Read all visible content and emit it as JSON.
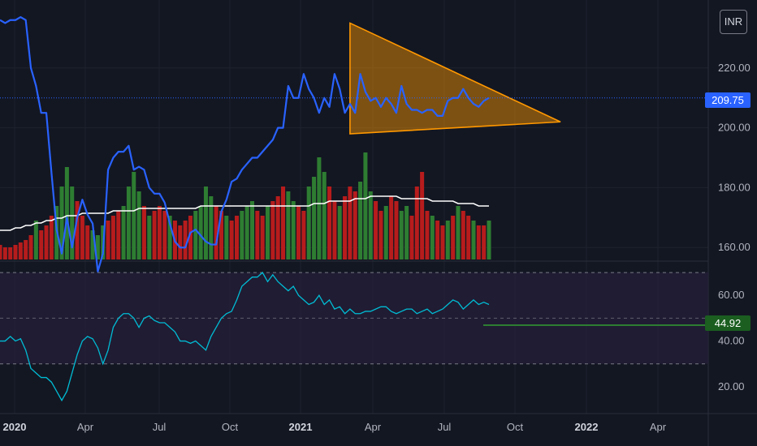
{
  "currency_button": "INR",
  "colors": {
    "background": "#131722",
    "price_line": "#2962ff",
    "rsi_line": "#00bcd4",
    "volume_up": "#2e7d32",
    "volume_down": "#b71c1c",
    "volume_ma": "#ffffff",
    "triangle_stroke": "#ff9800",
    "triangle_fill": "#ff9800",
    "current_price_badge": "#2962ff",
    "rsi_badge": "#1b5e20",
    "rsi_band": "#2a2040"
  },
  "chart_data": [
    {
      "type": "line",
      "name": "price",
      "x_tick_labels": [
        "2020",
        "Apr",
        "Jul",
        "Oct",
        "2021",
        "Apr",
        "Jul",
        "Oct",
        "2022",
        "Apr"
      ],
      "y_tick_labels": [
        "220.00",
        "200.00",
        "180.00",
        "160.00"
      ],
      "ylim": [
        156,
        240
      ],
      "current_value_label": "209.75",
      "series": [
        {
          "values": [
            236,
            235,
            236,
            236,
            237,
            236,
            220,
            214,
            205,
            205,
            185,
            166,
            158,
            170,
            160,
            170,
            176,
            171,
            168,
            152,
            158,
            186,
            190,
            192,
            192,
            194,
            186,
            187,
            186,
            180,
            178,
            178,
            175,
            168,
            162,
            160,
            160,
            165,
            166,
            164,
            162,
            161,
            161,
            172,
            176,
            182,
            183,
            186,
            188,
            190,
            190,
            192,
            194,
            196,
            200,
            200,
            214,
            210,
            210,
            218,
            213,
            210,
            205,
            210,
            207,
            218,
            213,
            205,
            208,
            205,
            218,
            212,
            209,
            210,
            207,
            210,
            208,
            205,
            214,
            208,
            206,
            206,
            205,
            206,
            206,
            204,
            204,
            209,
            210,
            210,
            213,
            210,
            208,
            207,
            209,
            210
          ]
        }
      ],
      "annotations": [
        {
          "type": "triangle",
          "points": [
            [
              68,
              235
            ],
            [
              68,
              198
            ],
            [
              125,
              202
            ]
          ]
        }
      ]
    },
    {
      "type": "bar",
      "name": "volume",
      "series": [
        {
          "values": [
            6,
            5,
            5,
            6,
            7,
            8,
            10,
            16,
            12,
            14,
            18,
            22,
            30,
            38,
            30,
            24,
            18,
            14,
            12,
            10,
            14,
            16,
            18,
            20,
            22,
            30,
            36,
            28,
            22,
            18,
            20,
            22,
            20,
            18,
            16,
            14,
            16,
            18,
            20,
            22,
            30,
            26,
            22,
            20,
            18,
            16,
            18,
            20,
            22,
            24,
            20,
            18,
            22,
            24,
            26,
            30,
            28,
            24,
            22,
            20,
            30,
            34,
            42,
            36,
            30,
            24,
            22,
            26,
            30,
            28,
            32,
            44,
            28,
            24,
            20,
            22,
            26,
            24,
            20,
            22,
            18,
            30,
            36,
            20,
            18,
            16,
            14,
            16,
            18,
            22,
            20,
            18,
            16,
            14,
            14,
            16
          ],
          "up": [
            0,
            0,
            0,
            0,
            0,
            0,
            0,
            1,
            0,
            0,
            0,
            1,
            1,
            1,
            1,
            0,
            0,
            0,
            1,
            1,
            1,
            0,
            0,
            0,
            1,
            1,
            1,
            1,
            0,
            1,
            0,
            0,
            0,
            1,
            0,
            0,
            0,
            0,
            1,
            1,
            1,
            1,
            0,
            0,
            1,
            0,
            0,
            1,
            1,
            1,
            0,
            0,
            1,
            0,
            0,
            0,
            1,
            1,
            0,
            0,
            1,
            1,
            1,
            1,
            0,
            0,
            1,
            0,
            0,
            0,
            1,
            1,
            1,
            0,
            0,
            1,
            0,
            0,
            1,
            1,
            0,
            0,
            0,
            0,
            1,
            0,
            0,
            1,
            0,
            1,
            0,
            0,
            1,
            0,
            0,
            1
          ]
        },
        {
          "name": "ma",
          "values": [
            12,
            12,
            12,
            13,
            13,
            14,
            14,
            15,
            15,
            16,
            16,
            17,
            17,
            18,
            18,
            18,
            19,
            19,
            19,
            19,
            19,
            19,
            20,
            20,
            20,
            20,
            20,
            21,
            21,
            21,
            21,
            21,
            21,
            21,
            21,
            21,
            21,
            21,
            21,
            22,
            22,
            22,
            22,
            22,
            22,
            22,
            22,
            22,
            22,
            22,
            22,
            22,
            22,
            22,
            22,
            22,
            22,
            22,
            22,
            22,
            22,
            23,
            23,
            23,
            24,
            24,
            24,
            24,
            24,
            25,
            25,
            25,
            26,
            26,
            26,
            26,
            26,
            26,
            25,
            25,
            25,
            25,
            25,
            25,
            24,
            24,
            24,
            24,
            24,
            23,
            23,
            23,
            23,
            22,
            22,
            22
          ]
        }
      ]
    },
    {
      "type": "line",
      "name": "rsi",
      "y_tick_labels": [
        "60.00",
        "40.00",
        "20.00"
      ],
      "ylim": [
        10,
        75
      ],
      "band": [
        30,
        70
      ],
      "midline": 50,
      "current_value_label": "44.92",
      "series": [
        {
          "values": [
            40,
            40,
            42,
            40,
            41,
            36,
            28,
            26,
            24,
            24,
            22,
            18,
            14,
            18,
            26,
            34,
            40,
            42,
            41,
            37,
            30,
            36,
            46,
            50,
            52,
            52,
            50,
            46,
            50,
            51,
            49,
            48,
            48,
            46,
            44,
            40,
            40,
            39,
            40,
            38,
            36,
            42,
            46,
            50,
            52,
            53,
            58,
            64,
            66,
            68,
            68,
            70,
            66,
            69,
            66,
            64,
            62,
            64,
            60,
            58,
            56,
            57,
            60,
            56,
            58,
            54,
            55,
            52,
            54,
            52,
            52,
            53,
            53,
            54,
            55,
            55,
            53,
            52,
            53,
            54,
            54,
            52,
            53,
            54,
            52,
            53,
            54,
            56,
            58,
            57,
            54,
            56,
            58,
            56,
            57,
            56
          ]
        }
      ]
    }
  ]
}
